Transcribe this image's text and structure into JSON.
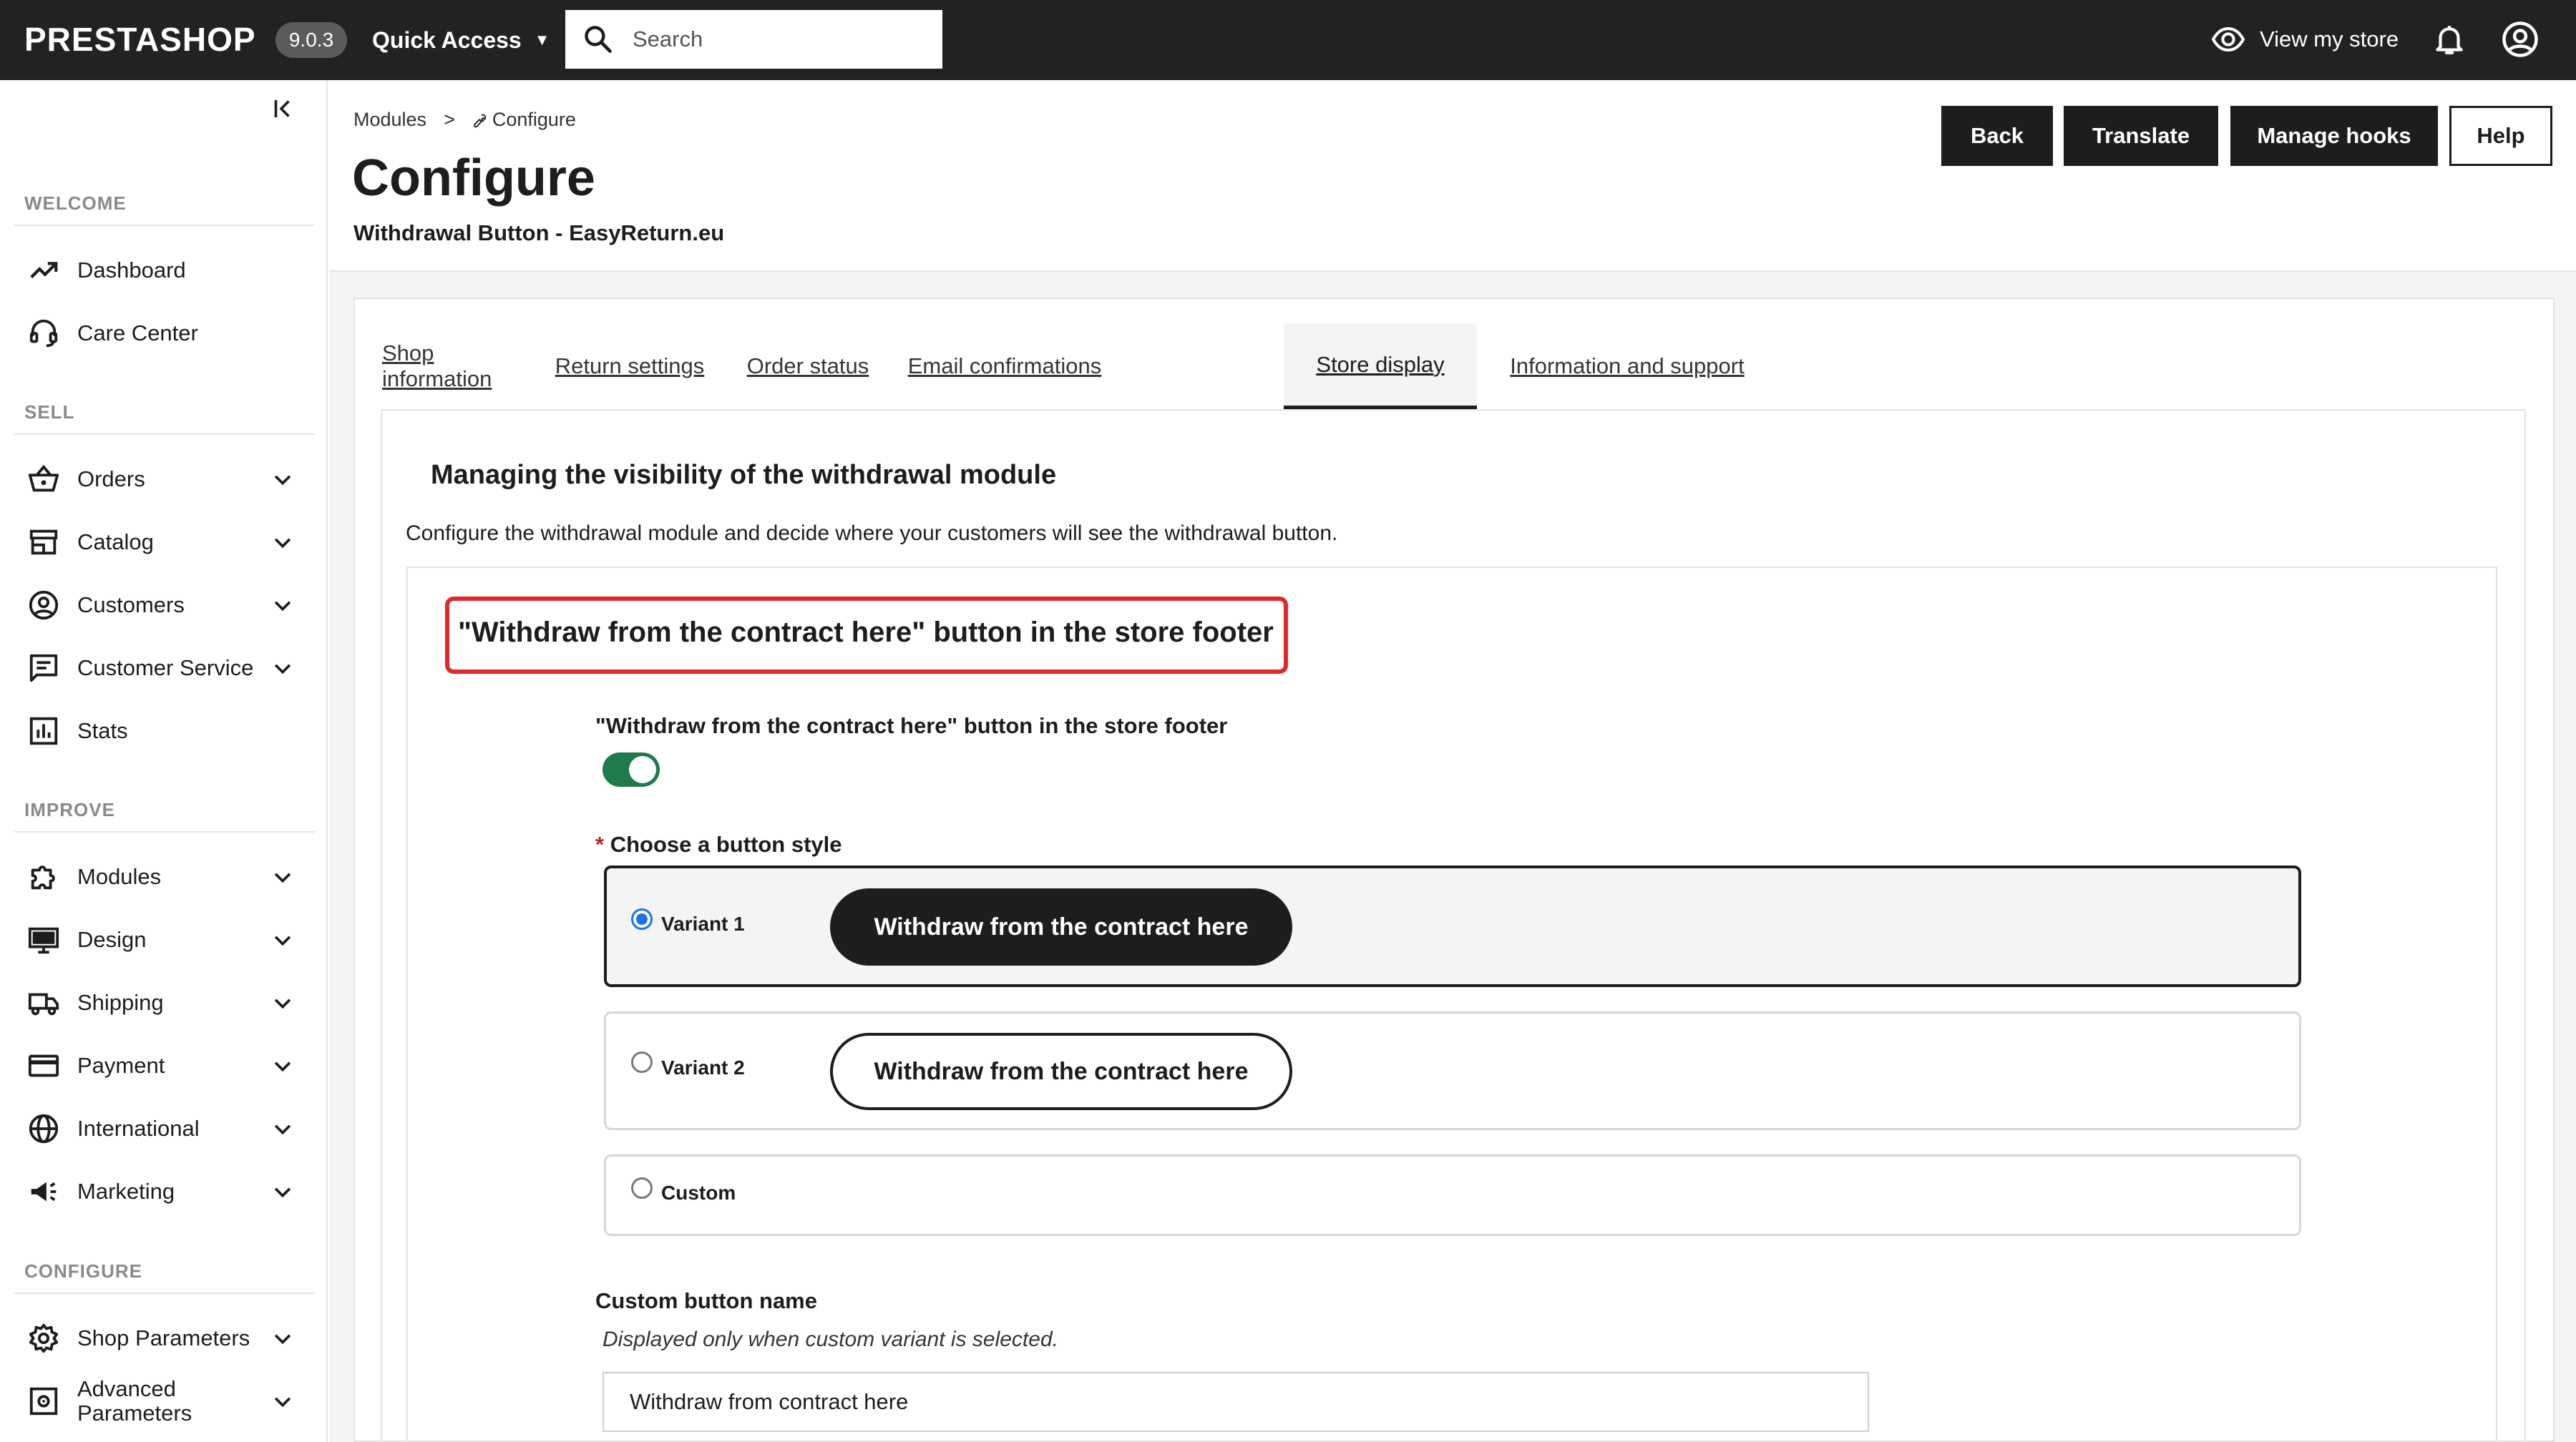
{
  "topbar": {
    "logo": "PRESTASHOP",
    "version": "9.0.3",
    "quick_access": "Quick Access",
    "search_placeholder": "Search",
    "view_store": "View my store"
  },
  "sidebar": {
    "sections": {
      "welcome": "WELCOME",
      "sell": "SELL",
      "improve": "IMPROVE",
      "configure": "CONFIGURE"
    },
    "items": [
      {
        "label": "Dashboard",
        "icon": "trending-up-icon"
      },
      {
        "label": "Care Center",
        "icon": "headset-icon"
      },
      {
        "label": "Orders",
        "icon": "basket-icon"
      },
      {
        "label": "Catalog",
        "icon": "store-icon"
      },
      {
        "label": "Customers",
        "icon": "account-circle-icon"
      },
      {
        "label": "Customer Service",
        "icon": "chat-icon"
      },
      {
        "label": "Stats",
        "icon": "bar-chart-icon"
      },
      {
        "label": "Modules",
        "icon": "puzzle-icon"
      },
      {
        "label": "Design",
        "icon": "monitor-icon"
      },
      {
        "label": "Shipping",
        "icon": "truck-icon"
      },
      {
        "label": "Payment",
        "icon": "credit-card-icon"
      },
      {
        "label": "International",
        "icon": "globe-icon"
      },
      {
        "label": "Marketing",
        "icon": "megaphone-icon"
      },
      {
        "label": "Shop Parameters",
        "icon": "gear-icon"
      },
      {
        "label": "Advanced Parameters",
        "icon": "settings-box-icon"
      }
    ]
  },
  "header": {
    "breadcrumb": [
      "Modules",
      "Configure"
    ],
    "breadcrumb_separator": ">",
    "title": "Configure",
    "subtitle": "Withdrawal Button - EasyReturn.eu",
    "buttons": {
      "back": "Back",
      "translate": "Translate",
      "manage_hooks": "Manage hooks",
      "help": "Help"
    }
  },
  "tabs": [
    {
      "label": "Shop information",
      "active": false
    },
    {
      "label": "Return settings",
      "active": false
    },
    {
      "label": "Order status",
      "active": false
    },
    {
      "label": "Email confirmations",
      "active": false
    },
    {
      "label": "Store display",
      "active": true
    },
    {
      "label": "Information and support",
      "active": false
    }
  ],
  "panel": {
    "title": "Managing the visibility of the withdrawal module",
    "description": "Configure the withdrawal module and decide where your customers will see the withdrawal button.",
    "section_heading": "\"Withdraw from the contract here\" button in the store footer",
    "toggle_label": "\"Withdraw from the contract here\" button in the store footer",
    "toggle_on": true,
    "button_style_label": "Choose a button style",
    "required_mark": "*",
    "variants": [
      {
        "label": "Variant 1",
        "preview": "Withdraw from the contract here",
        "checked": true
      },
      {
        "label": "Variant 2",
        "preview": "Withdraw from the contract here",
        "checked": false
      },
      {
        "label": "Custom",
        "checked": false
      }
    ],
    "custom_name_label": "Custom button name",
    "custom_name_help": "Displayed only when custom variant is selected.",
    "custom_name_value": "Withdraw from contract here"
  },
  "colors": {
    "topbar": "#222222",
    "highlight": "#e3262b",
    "toggle_on": "#1f7a4c",
    "radio_checked": "#1a73e8",
    "button_dark": "#1d1d1b"
  }
}
